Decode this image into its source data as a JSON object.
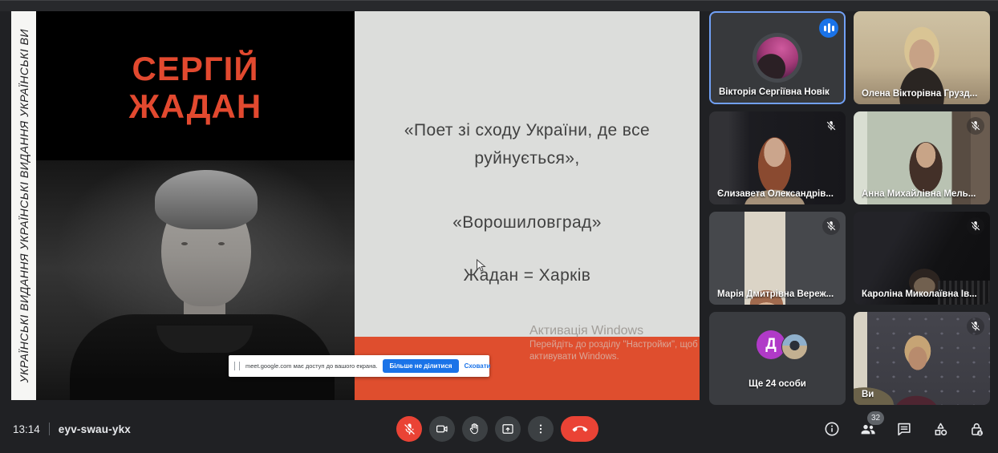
{
  "app": {
    "time": "13:14",
    "meeting_code": "eyv-swau-ykx",
    "participants_badge": "32"
  },
  "slide": {
    "side_text": "УКРАЇНСЬКІ ВИДАННЯ УКРАЇНСЬКІ ВИДАННЯ УКРАЇНСЬКІ ВИ",
    "title_line1": "СЕРГІЙ",
    "title_line2": "ЖАДАН",
    "quote1_line1": "«Поет зі сходу України, де все",
    "quote1_line2": "руйнується»,",
    "quote2": "«Ворошиловград»",
    "quote3": "Жадан = Харків",
    "accent_color": "#e2492f",
    "band_color": "#df4e2e"
  },
  "watermark": {
    "line1": "Активація Windows",
    "line2": "Перейдіть до розділу \"Настройки\", щоб",
    "line3": "активувати Windows."
  },
  "share_banner": {
    "message": "meet.google.com має доступ до вашого екрана.",
    "stop_sharing_label": "Більше не ділитися",
    "hide_label": "Сховати",
    "accent_color": "#1a73e8"
  },
  "participants": [
    {
      "name": "Вікторія Сергіївна Новік",
      "state": "speaking"
    },
    {
      "name": "Олена Вікторівна Грузд...",
      "state": "camera-on"
    },
    {
      "name": "Єлизавета Олександрів...",
      "state": "muted"
    },
    {
      "name": "Анна Михайлівна Мель...",
      "state": "muted"
    },
    {
      "name": "Марія Дмитрівна Вереж...",
      "state": "muted"
    },
    {
      "name": "Кароліна Миколаївна Ів...",
      "state": "muted"
    },
    {
      "name": "Ще 24 особи",
      "state": "overflow",
      "avatar_letter": "Д"
    },
    {
      "name": "Ви",
      "state": "muted"
    }
  ],
  "toolbar": {
    "controls": [
      "microphone-muted",
      "camera",
      "raise-hand",
      "present-screen",
      "more-options",
      "leave-call"
    ],
    "right_icons": [
      "info",
      "participants",
      "chat",
      "activities",
      "host-controls"
    ],
    "mute_color": "#ea4335"
  }
}
